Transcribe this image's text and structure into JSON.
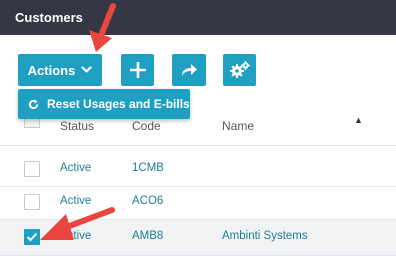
{
  "header": {
    "title": "Customers"
  },
  "toolbar": {
    "actions_label": "Actions",
    "actions_icon": "chevron-down-icon",
    "add_icon": "plus-icon",
    "share_icon": "share-arrow-icon",
    "settings_icon": "gears-icon",
    "accent_color": "#1fa0c3"
  },
  "dropdown": {
    "items": [
      {
        "label": "Reset Usages and E-bills",
        "icon": "refresh-icon"
      }
    ]
  },
  "table": {
    "columns": [
      "Status",
      "Code",
      "Name"
    ],
    "sort_column": "Name",
    "sort_direction": "ascending",
    "rows": [
      {
        "selected": false,
        "status": "Active",
        "code": "1CMB",
        "name": ""
      },
      {
        "selected": false,
        "status": "Active",
        "code": "ACO6",
        "name": ""
      },
      {
        "selected": true,
        "status": "Active",
        "code": "AMB8",
        "name": "Ambinti Systems"
      }
    ]
  },
  "annotations": {
    "arrow_color": "#e8463f"
  }
}
